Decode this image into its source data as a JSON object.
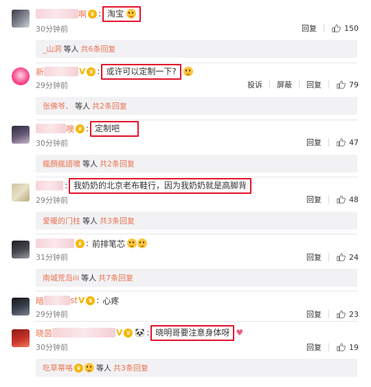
{
  "comments": [
    {
      "username_visible": "啊",
      "text": "淘宝",
      "time": "30分钟前",
      "reply_label": "回复",
      "likes": "150",
      "reply_summary": {
        "name": "_山洞",
        "mid": "等人",
        "count": "共6条回复"
      }
    },
    {
      "username_visible": "新",
      "text": "或许可以定制一下?",
      "time": "29分钟前",
      "report_label": "投诉",
      "block_label": "屏蔽",
      "reply_label": "回复",
      "likes": "79",
      "reply_summary": {
        "name": "张佛爷、",
        "mid": "等人",
        "count": "共2条回复"
      }
    },
    {
      "username_visible": "噢",
      "text": "定制吧",
      "time": "30分钟前",
      "reply_label": "回复",
      "likes": "47",
      "reply_summary": {
        "name": "瘋顏瘋語噢",
        "mid": "等人",
        "count": "共2条回复"
      }
    },
    {
      "username_visible": "",
      "text": "我奶奶的北京老布鞋行，因为我奶奶就是高脚背",
      "time": "29分钟前",
      "reply_label": "回复",
      "likes": "48",
      "reply_summary": {
        "name": "爱暖的门柱",
        "mid": "等人",
        "count": "共3条回复"
      }
    },
    {
      "username_visible": "",
      "text": "前排笔芯",
      "time": "31分钟前",
      "reply_label": "回复",
      "likes": "24",
      "reply_summary": {
        "name": "南城荒岛iii",
        "mid": "等人",
        "count": "共7条回复"
      }
    },
    {
      "username_visible": "暗",
      "username_suffix": "st",
      "text": "心疼",
      "time": "29分钟前",
      "reply_label": "回复",
      "likes": "23"
    },
    {
      "username_visible": "晓茵",
      "text": "晓明哥要注意身体呀",
      "time": "30分钟前",
      "reply_label": "回复",
      "likes": "19",
      "reply_summary": {
        "name": "吃草蒂咯",
        "mid": "等人",
        "count": "共3条回复"
      }
    }
  ],
  "colors": {
    "accent": "#eb7350",
    "highlight_box": "#e3102a",
    "reply_bg": "#f2f2f5"
  }
}
